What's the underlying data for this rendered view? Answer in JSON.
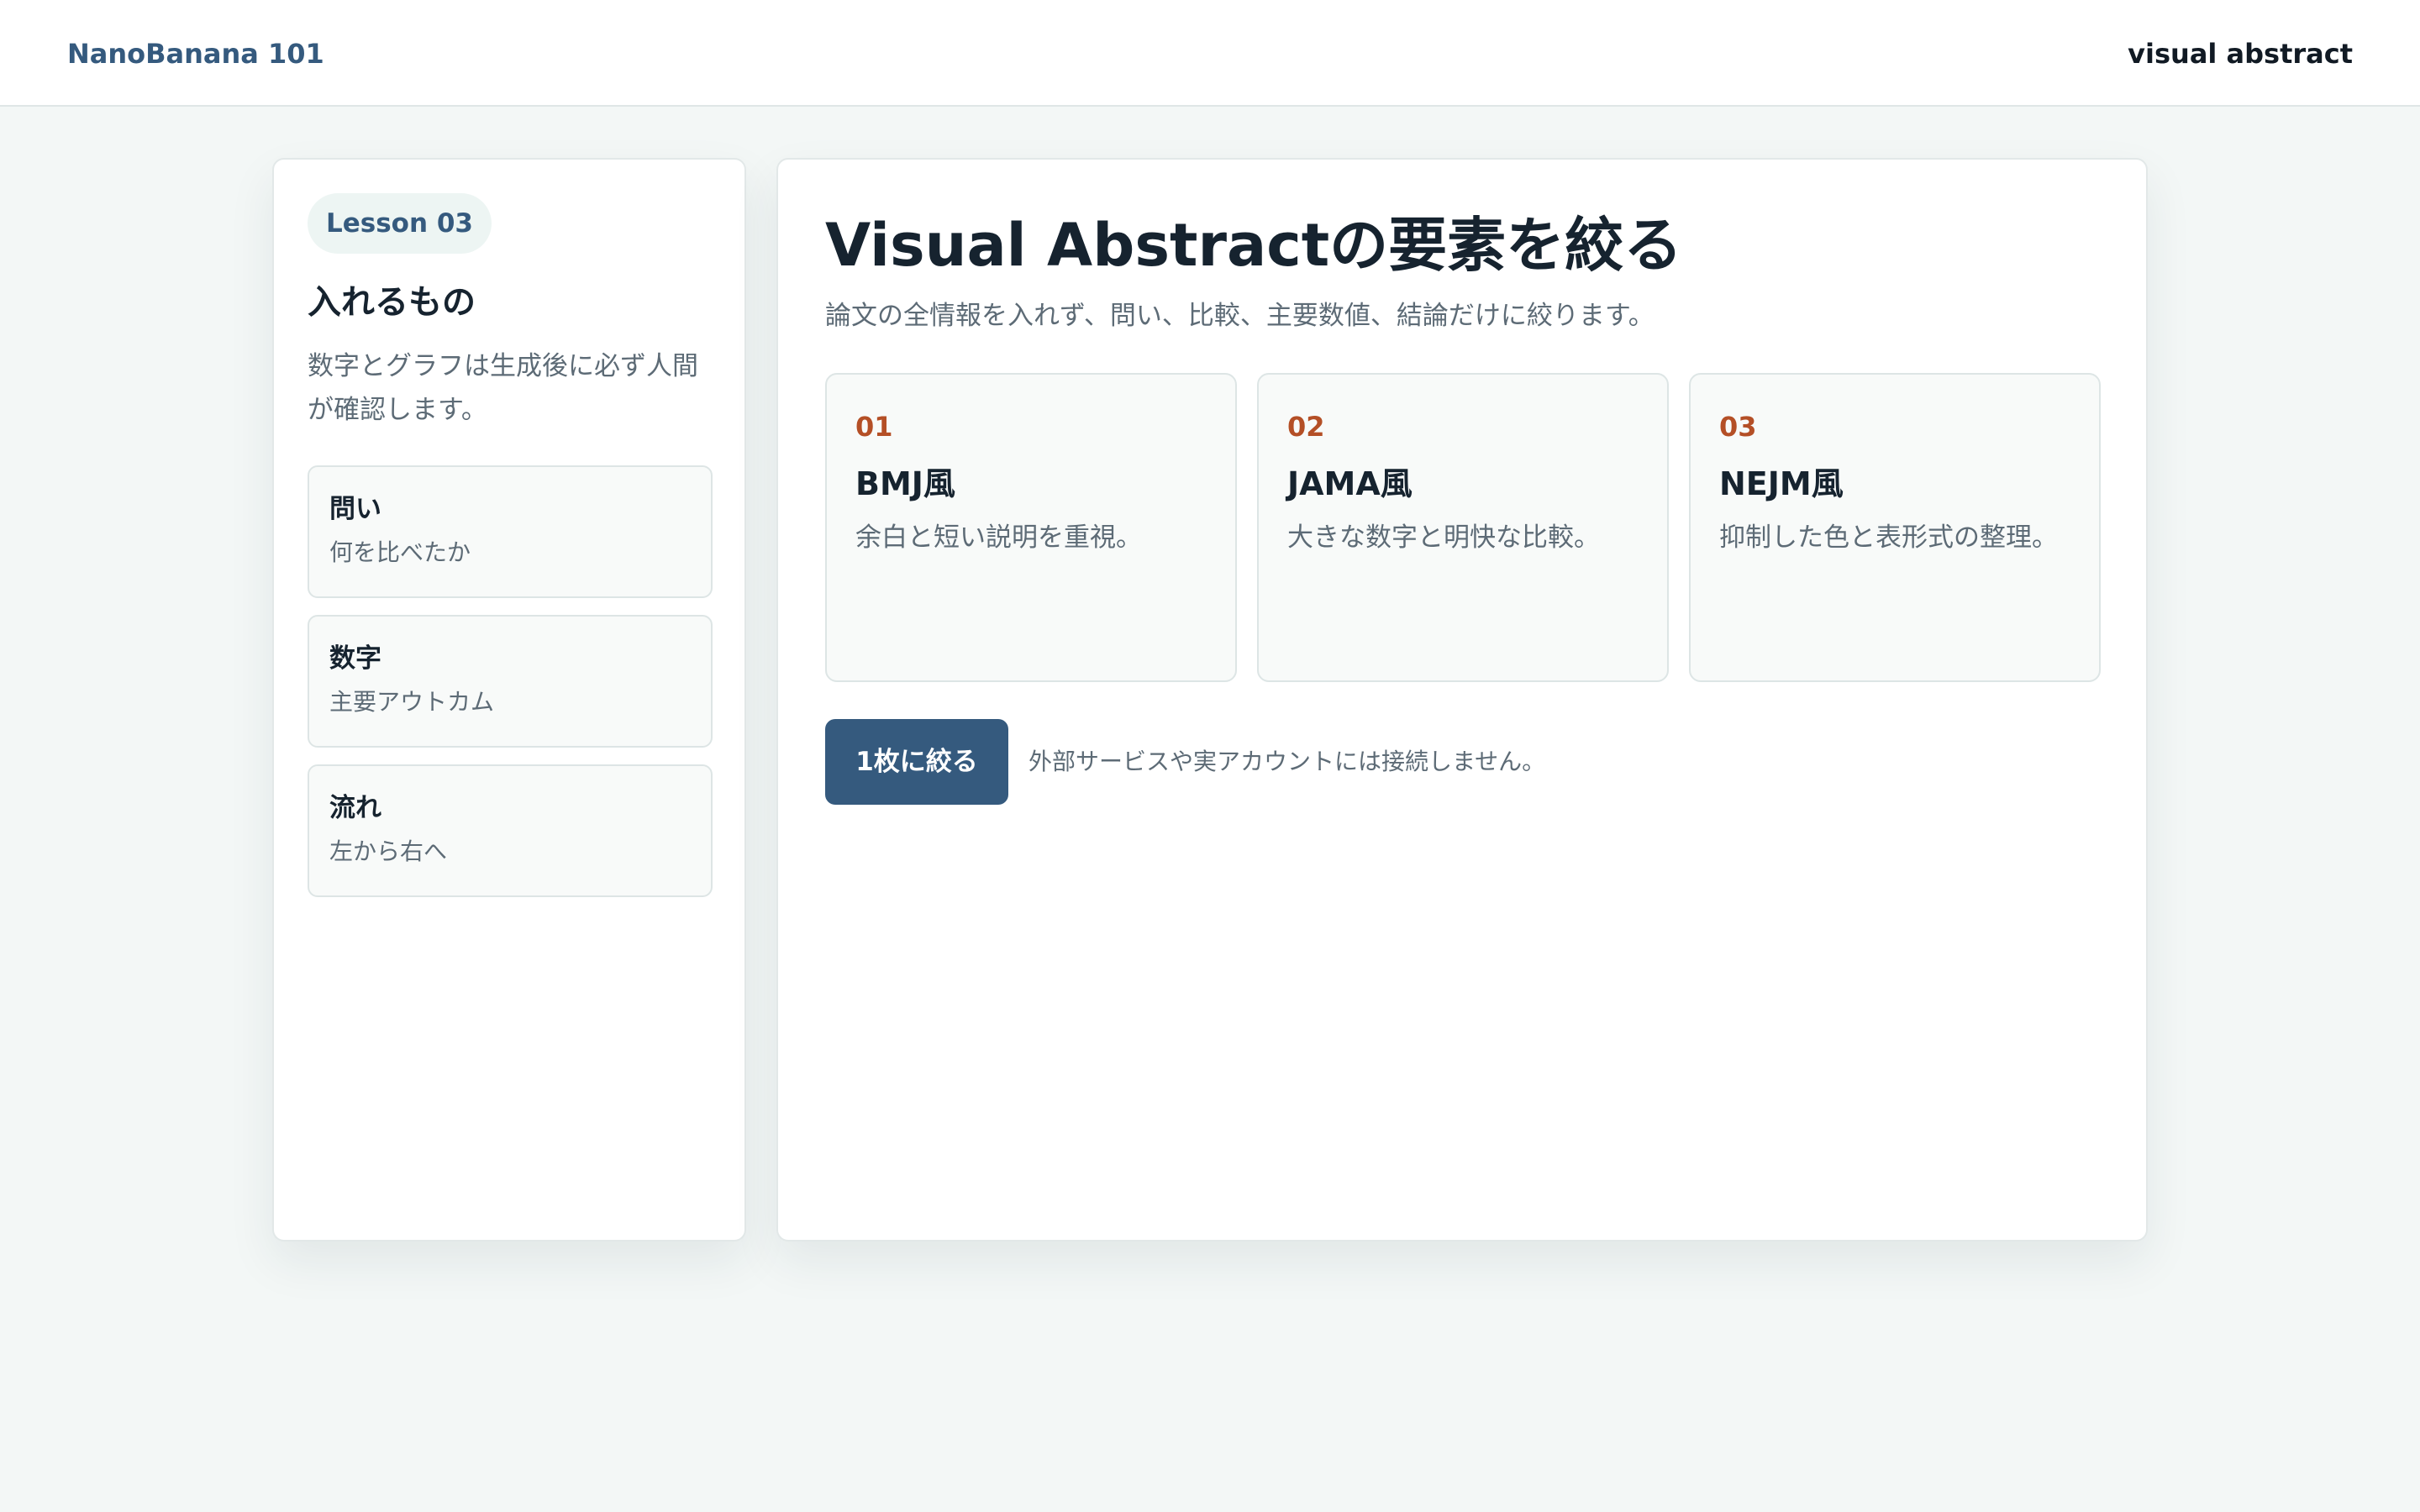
{
  "header": {
    "brand": "NanoBanana 101",
    "right_label": "visual abstract"
  },
  "sidebar": {
    "badge": "Lesson 03",
    "title": "入れるもの",
    "description": "数字とグラフは生成後に必ず人間が確認します。",
    "items": [
      {
        "title": "問い",
        "subtitle": "何を比べたか"
      },
      {
        "title": "数字",
        "subtitle": "主要アウトカム"
      },
      {
        "title": "流れ",
        "subtitle": "左から右へ"
      }
    ]
  },
  "main": {
    "title": "Visual Abstractの要素を絞る",
    "description": "論文の全情報を入れず、問い、比較、主要数値、結論だけに絞ります。",
    "cards": [
      {
        "number": "01",
        "title": "BMJ風",
        "description": "余白と短い説明を重視。"
      },
      {
        "number": "02",
        "title": "JAMA風",
        "description": "大きな数字と明快な比較。"
      },
      {
        "number": "03",
        "title": "NEJM風",
        "description": "抑制した色と表形式の整理。"
      }
    ],
    "action_button": "1枚に絞る",
    "action_note": "外部サービスや実アカウントには接続しません。"
  },
  "colors": {
    "background": "#f3f7f6",
    "accent": "#355a7e",
    "card_number": "#b44f26",
    "text": "#16232f",
    "muted_text": "#5d6b76"
  }
}
